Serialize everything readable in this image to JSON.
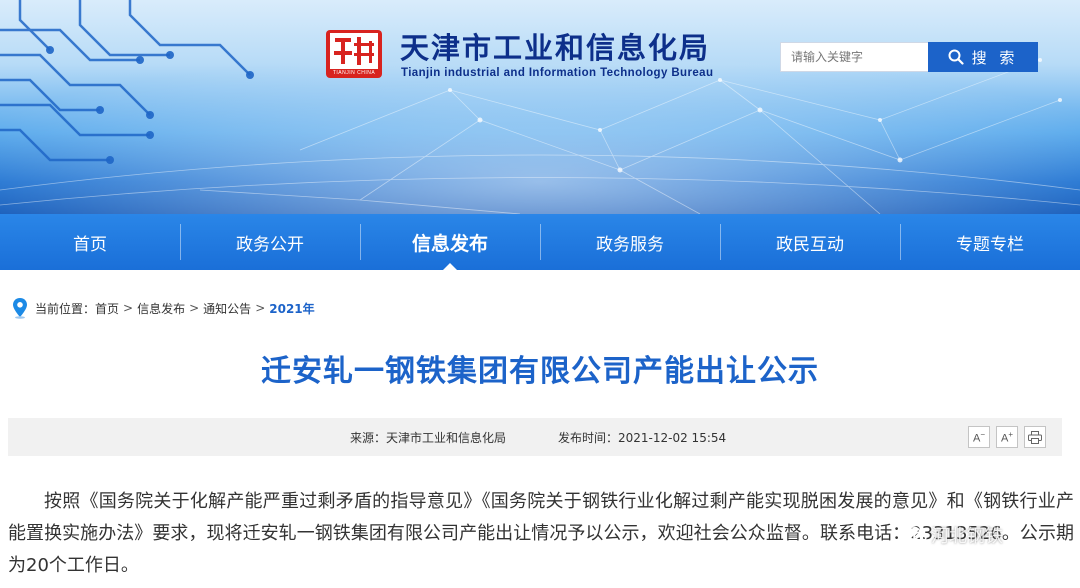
{
  "header": {
    "title": "天津市工业和信息化局",
    "subtitle": "Tianjin industrial and Information Technology Bureau",
    "logo_seal_text": "TIANJIN CHINA"
  },
  "search": {
    "placeholder": "请输入关键字",
    "button_label": "搜 索"
  },
  "nav": {
    "items": [
      {
        "label": "首页"
      },
      {
        "label": "政务公开"
      },
      {
        "label": "信息发布"
      },
      {
        "label": "政务服务"
      },
      {
        "label": "政民互动"
      },
      {
        "label": "专题专栏"
      }
    ],
    "active": "信息发布"
  },
  "breadcrumb": {
    "prefix": "当前位置：",
    "items": [
      "首页",
      "信息发布",
      "通知公告",
      "2021年"
    ],
    "separator": ">"
  },
  "article": {
    "title": "迁安轧一钢铁集团有限公司产能出让公示",
    "source": "来源：天津市工业和信息化局",
    "publish_time": "发布时间：2021-12-02 15:54",
    "tools": {
      "font_down": "A",
      "font_up": "A",
      "print": "print"
    },
    "body": "按照《国务院关于化解产能严重过剩矛盾的指导意见》《国务院关于钢铁行业化解过剩产能实现脱困发展的意见》和《钢铁行业产能置换实施办法》要求，现将迁安轧一钢铁集团有限公司产能出让情况予以公示，欢迎社会公众监督。联系电话：23313526。公示期为20个工作日。"
  },
  "watermark": {
    "text": "河北钢铁"
  },
  "colors": {
    "accent": "#1c63c9",
    "nav_bg": "#1a6fd8",
    "title_dark": "#0d2f8a",
    "seal_red": "#d8231f"
  }
}
